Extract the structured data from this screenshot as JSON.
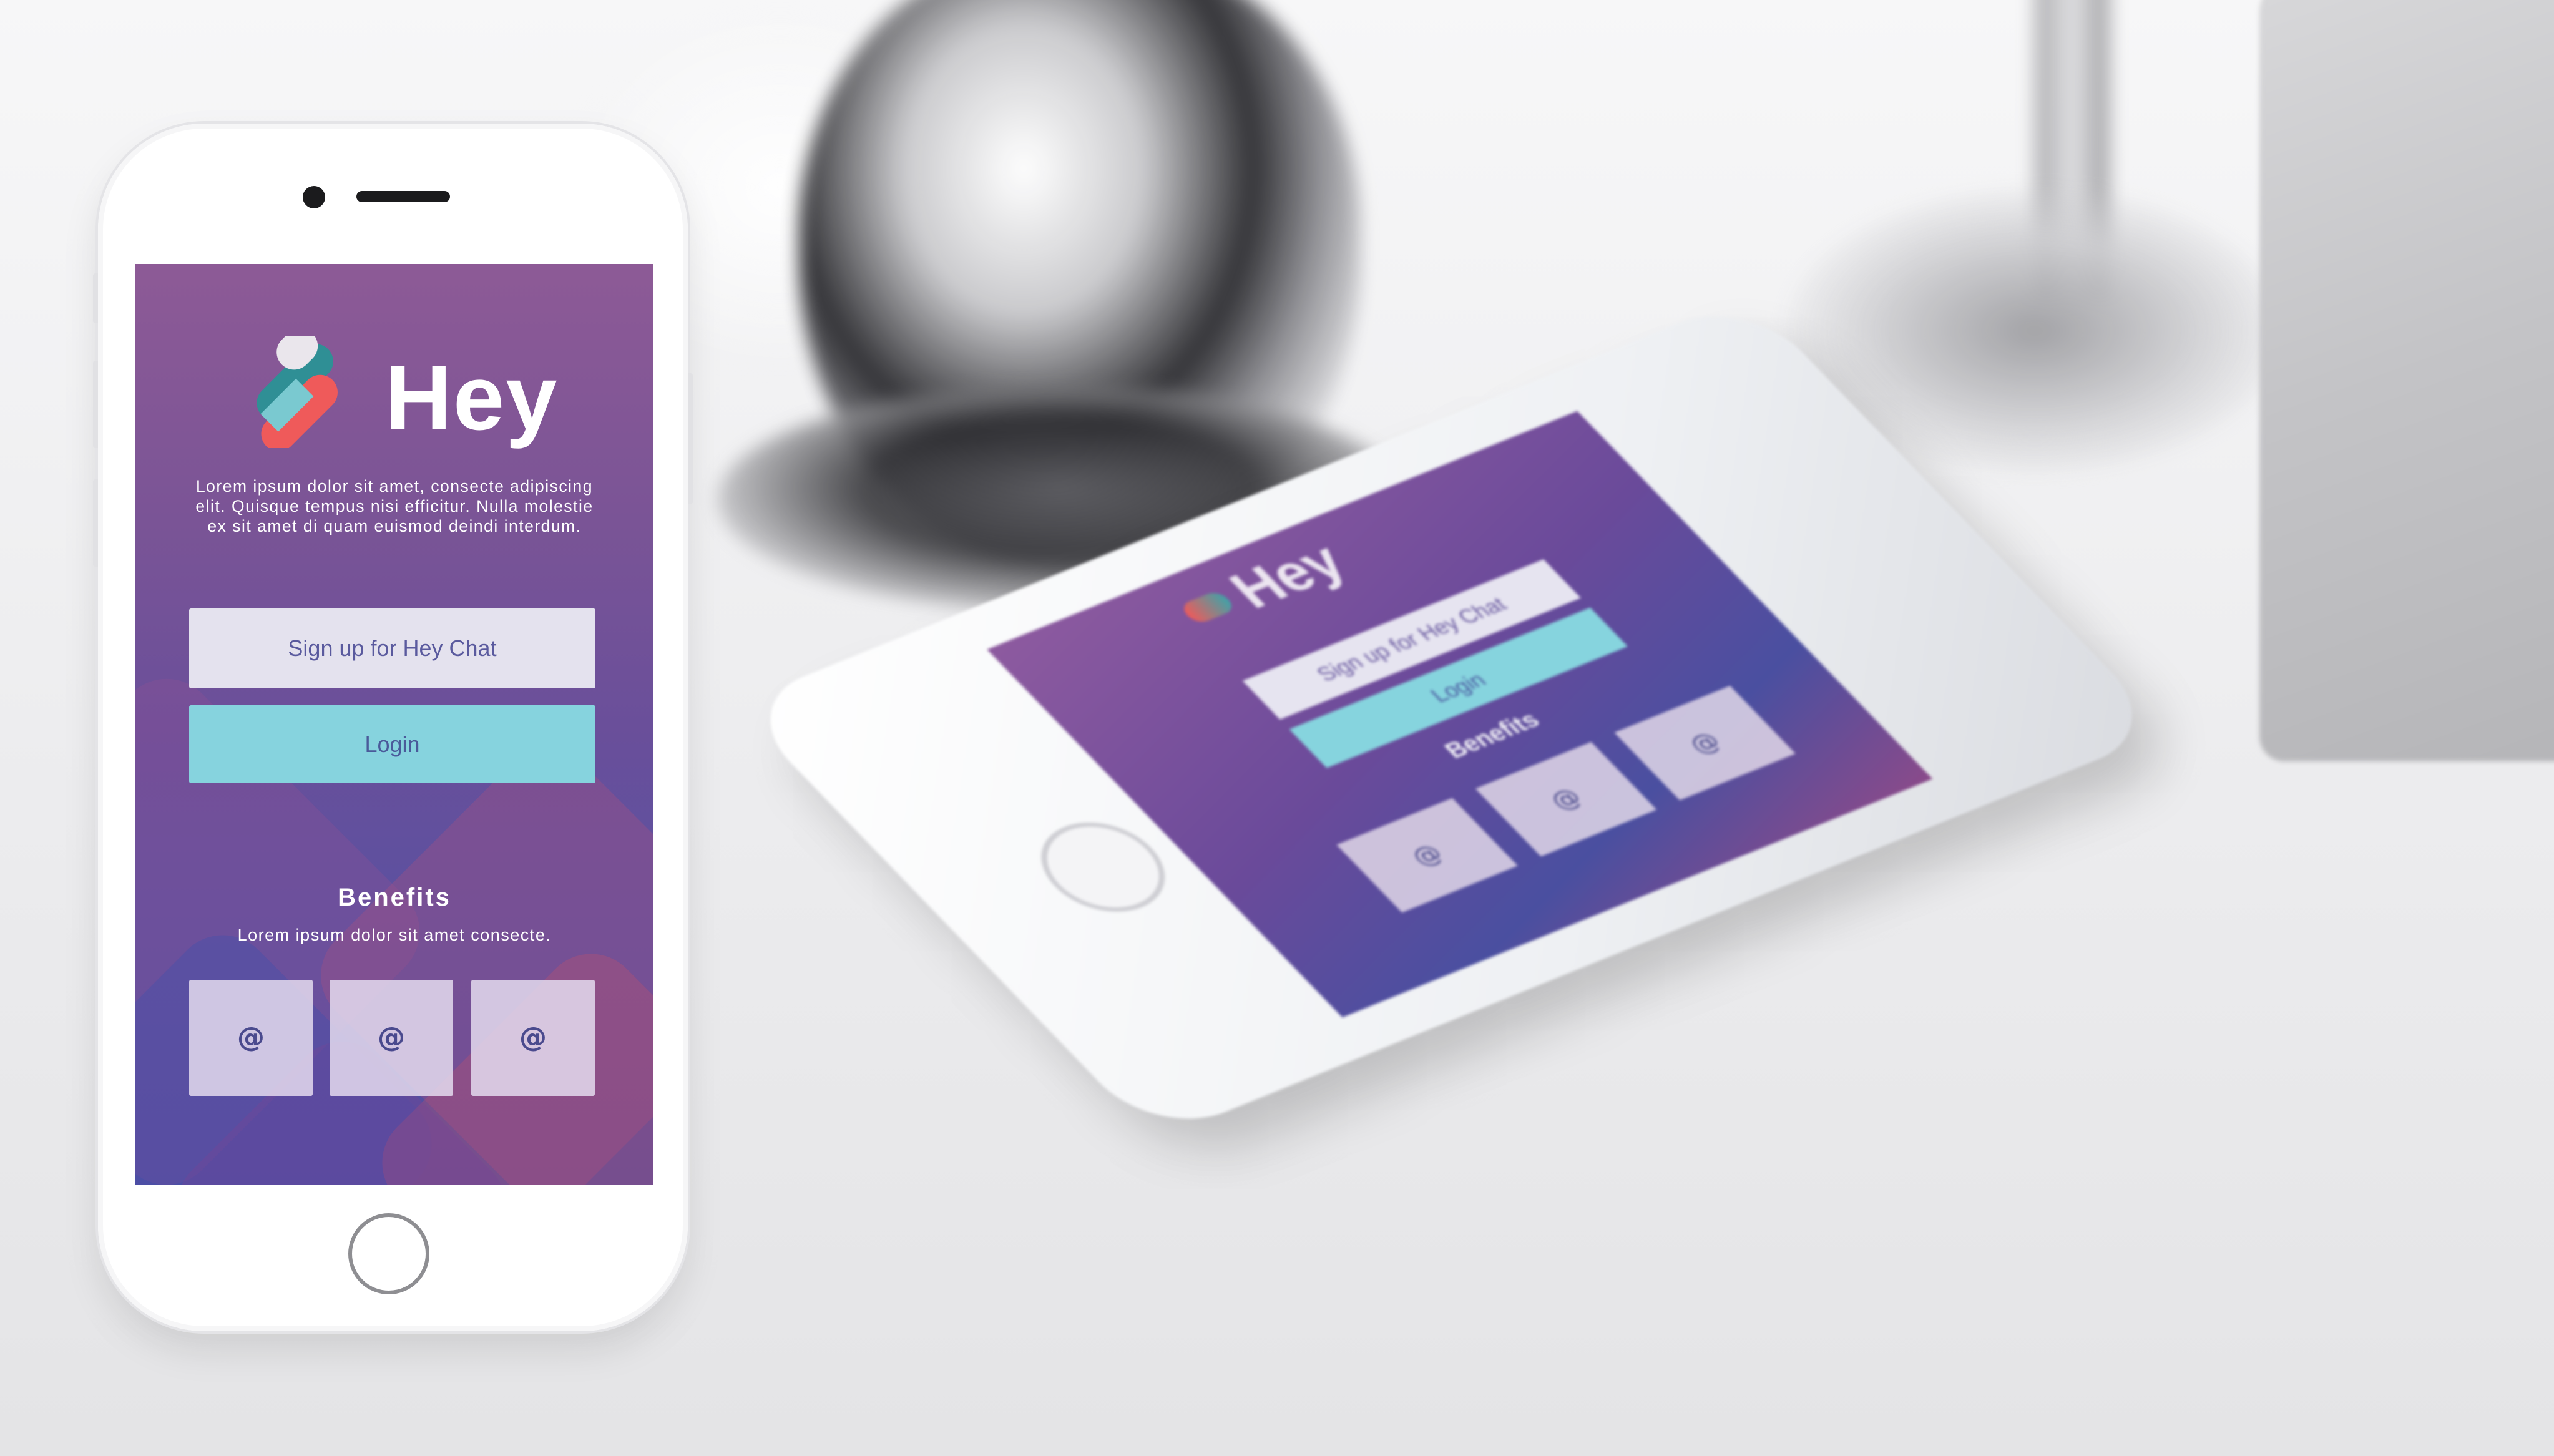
{
  "app": {
    "title": "Hey",
    "description": "Lorem ipsum dolor sit amet, consecte adipiscing elit. Quisque tempus nisi efficitur. Nulla molestie ex sit amet di quam euismod deindi interdum."
  },
  "actions": {
    "signup_label": "Sign up for Hey Chat",
    "login_label": "Login"
  },
  "benefits": {
    "title": "Benefits",
    "subtitle": "Lorem ipsum dolor sit amet consecte.",
    "tiles": [
      {
        "icon": "at-icon",
        "glyph": "@"
      },
      {
        "icon": "at-icon",
        "glyph": "@"
      },
      {
        "icon": "at-icon",
        "glyph": "@"
      }
    ]
  },
  "colors": {
    "screen_gradient_top": "#8d5a96",
    "screen_gradient_bottom": "#514ea0",
    "signup_button": "#e4e2ee",
    "login_button": "#86d3de",
    "logo_red": "#ef5a5a",
    "logo_teal": "#2f8f95",
    "logo_light": "#eae6ec"
  }
}
